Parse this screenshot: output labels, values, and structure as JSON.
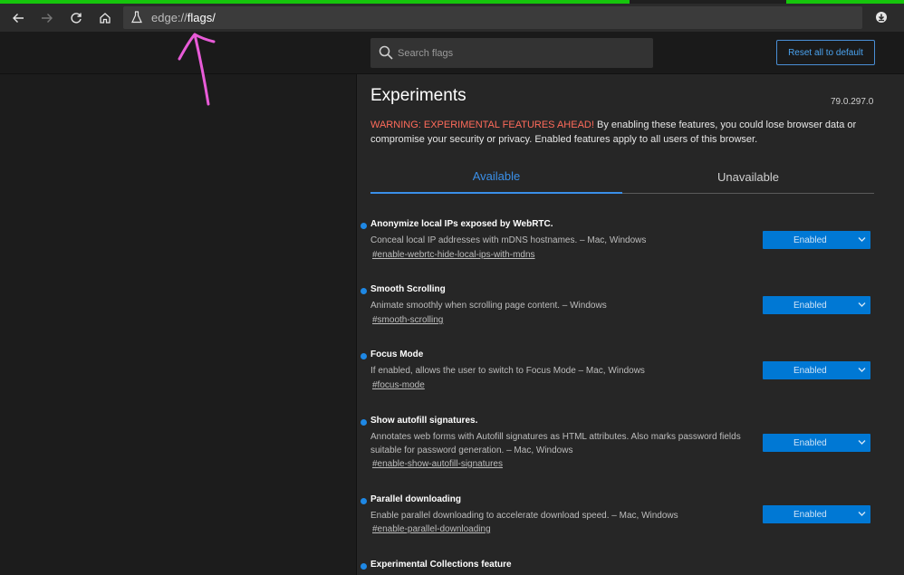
{
  "browser": {
    "url_prefix": "edge://",
    "url_path": "flags/",
    "icons": {
      "back": "back-arrow-icon",
      "forward": "forward-arrow-icon",
      "refresh": "refresh-icon",
      "home": "home-icon",
      "flask": "flask-icon",
      "extension": "download-extension-icon"
    }
  },
  "header": {
    "search_placeholder": "Search flags",
    "reset_label": "Reset all to default"
  },
  "main": {
    "title": "Experiments",
    "version": "79.0.297.0",
    "warning_strong": "WARNING: EXPERIMENTAL FEATURES AHEAD!",
    "warning_text": " By enabling these features, you could lose browser data or compromise your security or privacy. Enabled features apply to all users of this browser.",
    "tabs": [
      {
        "label": "Available"
      },
      {
        "label": "Unavailable"
      }
    ],
    "flags": [
      {
        "name": "Anonymize local IPs exposed by WebRTC.",
        "description": "Conceal local IP addresses with mDNS hostnames. – Mac, Windows",
        "link": "#enable-webrtc-hide-local-ips-with-mdns",
        "value": "Enabled"
      },
      {
        "name": "Smooth Scrolling",
        "description": "Animate smoothly when scrolling page content. – Windows",
        "link": "#smooth-scrolling",
        "value": "Enabled"
      },
      {
        "name": "Focus Mode",
        "description": "If enabled, allows the user to switch to Focus Mode – Mac, Windows",
        "link": "#focus-mode",
        "value": "Enabled"
      },
      {
        "name": "Show autofill signatures.",
        "description": "Annotates web forms with Autofill signatures as HTML attributes. Also marks password fields suitable for password generation. – Mac, Windows",
        "link": "#enable-show-autofill-signatures",
        "value": "Enabled"
      },
      {
        "name": "Parallel downloading",
        "description": "Enable parallel downloading to accelerate download speed. – Mac, Windows",
        "link": "#enable-parallel-downloading",
        "value": "Enabled"
      },
      {
        "name": "Experimental Collections feature"
      }
    ]
  },
  "colors": {
    "accent": "#1e88e5",
    "select_bg": "#0078d4",
    "warning": "#ff6b5b",
    "tab_progress": "#16c60c",
    "annotation": "#e85bd8"
  }
}
